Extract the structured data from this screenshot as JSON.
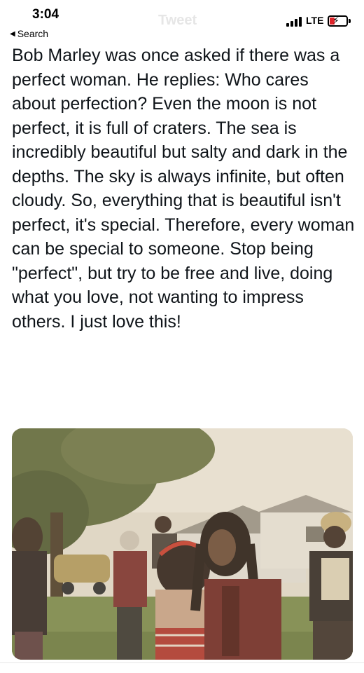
{
  "status_bar": {
    "time": "3:04",
    "network": "LTE",
    "battery_icon": "battery-charging-icon",
    "signal_icon": "cellular-signal-icon",
    "battery_color": "#e0242a"
  },
  "header": {
    "ghost_title": "Tweet"
  },
  "nav": {
    "back_label": "Search",
    "back_icon": "back-triangle-icon"
  },
  "post": {
    "text": "Bob Marley was once asked if there was a perfect woman. He replies: Who cares about perfection? Even the moon is not perfect, it is full of craters. The sea is incredibly beautiful but salty and dark in the depths. The sky is always infinite, but often cloudy. So, everything that is beautiful isn't perfect, it's special. Therefore, every woman can be special to someone. Stop being \"perfect\", but try to be free and live, doing what you love, not wanting to impress others. I just love this!",
    "photo_tint": "#c9b99a"
  }
}
